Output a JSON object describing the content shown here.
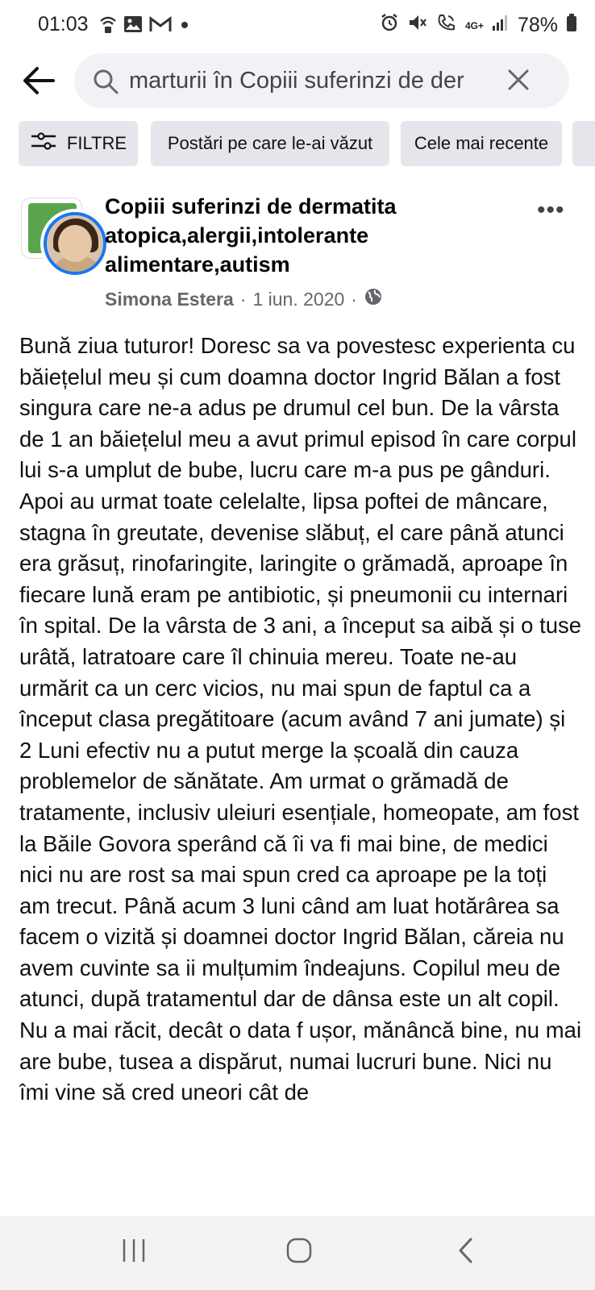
{
  "status_bar": {
    "time": "01:03",
    "network": "4G+",
    "battery": "78%",
    "left_icons": [
      "wifi-call-icon",
      "gallery-icon",
      "gmail-icon",
      "dot-icon"
    ],
    "right_icons": [
      "alarm-icon",
      "mute-icon",
      "volte-call-icon",
      "signal-icon",
      "battery-icon"
    ]
  },
  "search": {
    "value": "marturii în Copiii suferinzi de der",
    "back_icon": "back-arrow-icon",
    "search_icon": "search-icon",
    "clear_icon": "close-icon"
  },
  "filters": {
    "chips": [
      "FILTRE",
      "Postări pe care le-ai văzut",
      "Cele mai recente",
      ""
    ]
  },
  "post": {
    "group_name": "Copiii suferinzi de dermatita atopica,alergii,intolerante alimentare,autism",
    "author": "Simona Estera",
    "separator": "·",
    "date": "1 iun. 2020",
    "privacy_icon": "globe-icon",
    "more_label": "•••",
    "body": "Bună ziua tuturor! Doresc sa va povestesc experienta cu băiețelul meu și cum doamna doctor Ingrid Bălan a fost singura care ne-a adus pe drumul cel bun. De la vârsta de 1 an băiețelul meu a avut primul episod în care corpul lui s-a umplut de bube, lucru care m-a pus pe gânduri. Apoi au urmat toate celelalte, lipsa poftei de mâncare, stagna în greutate, devenise slăbuț, el care până atunci era grăsuț, rinofaringite, laringite o grămadă, aproape în fiecare lună eram pe antibiotic, și pneumonii cu internari în spital. De la vârsta de 3 ani, a început sa aibă și o tuse urâtă, latratoare care îl chinuia mereu. Toate ne-au urmărit ca un cerc vicios, nu mai spun de faptul ca a început clasa pregătitoare (acum având 7 ani jumate) și 2 Luni efectiv nu a putut merge la școală din cauza problemelor de sănătate. Am urmat o grămadă de tratamente, inclusiv uleiuri esențiale, homeopate, am fost la Băile Govora sperând că îi va fi mai bine, de medici nici nu are rost sa mai spun cred ca aproape pe la toți am trecut. Până acum 3 luni când am luat hotărârea sa facem o vizită și doamnei doctor Ingrid Bălan, căreia nu avem cuvinte sa ii mulțumim îndeajuns. Copilul meu de atunci, după tratamentul dar de dânsa este un alt copil. Nu a mai răcit, decât o data f ușor, mănâncă bine, nu mai are bube, tusea a dispărut, numai lucruri bune. Nici nu îmi vine să cred uneori cât de"
  },
  "nav_bar": {
    "buttons": [
      "recent-apps-icon",
      "home-icon",
      "back-icon"
    ]
  }
}
